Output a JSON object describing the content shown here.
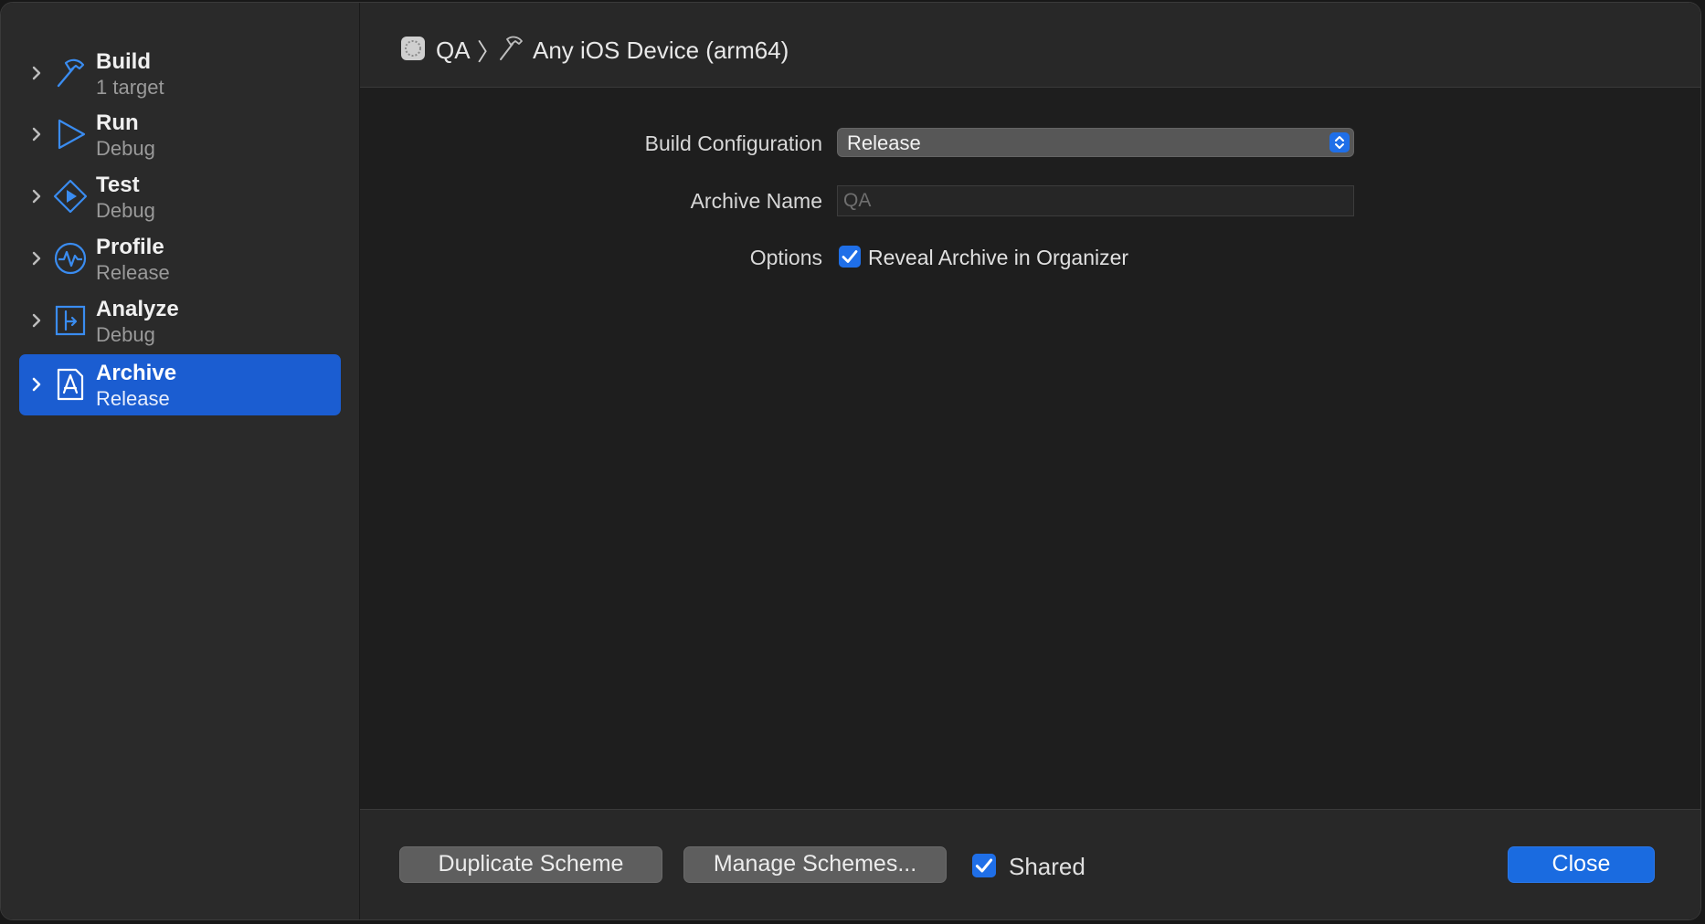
{
  "sidebar": {
    "items": [
      {
        "label": "Build",
        "sub": "1 target",
        "icon": "hammer-icon"
      },
      {
        "label": "Run",
        "sub": "Debug",
        "icon": "play-icon"
      },
      {
        "label": "Test",
        "sub": "Debug",
        "icon": "test-diamond-icon"
      },
      {
        "label": "Profile",
        "sub": "Release",
        "icon": "profile-gauge-icon"
      },
      {
        "label": "Analyze",
        "sub": "Debug",
        "icon": "analyze-icon"
      },
      {
        "label": "Archive",
        "sub": "Release",
        "icon": "archive-appstore-icon"
      }
    ],
    "selected_index": 5
  },
  "pathbar": {
    "scheme": "QA",
    "separator": "〉",
    "destination": "Any iOS Device (arm64)"
  },
  "form": {
    "build_config_label": "Build Configuration",
    "build_config_value": "Release",
    "archive_name_label": "Archive Name",
    "archive_name_placeholder": "QA",
    "options_label": "Options",
    "reveal_label": "Reveal Archive in Organizer",
    "reveal_checked": true
  },
  "footer": {
    "duplicate_label": "Duplicate Scheme",
    "manage_label": "Manage Schemes...",
    "shared_label": "Shared",
    "shared_checked": true,
    "close_label": "Close"
  },
  "colors": {
    "accent": "#1b5dd1",
    "icon_blue": "#3a8cf0",
    "background": "#1e1e1e",
    "sidebar": "#2a2a2a"
  }
}
